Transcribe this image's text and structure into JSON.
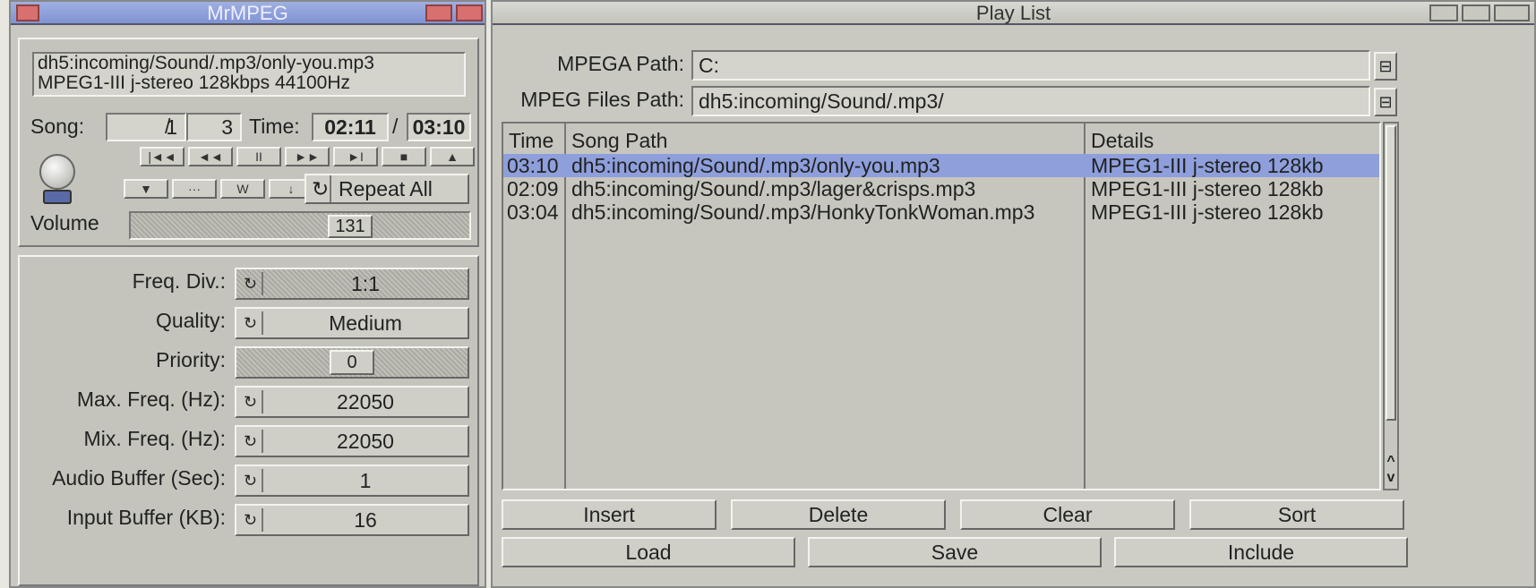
{
  "left_window": {
    "title": "MrMPEG",
    "file_line": "dh5:incoming/Sound/.mp3/only-you.mp3",
    "info_line": "MPEG1-III j-stereo 128kbps 44100Hz",
    "song_label": "Song:",
    "song_current": "1",
    "song_sep": "/",
    "song_total": "3",
    "time_label": "Time:",
    "time_elapsed": "02:11",
    "time_sep": "/",
    "time_total": "03:10",
    "transport": [
      "|◄◄",
      "◄◄",
      "II",
      "►►",
      "►I",
      "■",
      "▲"
    ],
    "transport2": [
      "▼",
      "···",
      "W",
      "↓"
    ],
    "repeat_icon": "↻",
    "repeat_label": "Repeat All",
    "volume_label": "Volume",
    "volume_value": "131",
    "settings": [
      {
        "label": "Freq. Div.:",
        "value": "1:1",
        "disabled": true,
        "cycle": true
      },
      {
        "label": "Quality:",
        "value": "Medium",
        "disabled": false,
        "cycle": true
      },
      {
        "label": "Priority:",
        "value": "0",
        "disabled": true,
        "cycle": false
      },
      {
        "label": "Max. Freq. (Hz):",
        "value": "22050",
        "disabled": false,
        "cycle": true
      },
      {
        "label": "Mix. Freq. (Hz):",
        "value": "22050",
        "disabled": false,
        "cycle": true
      },
      {
        "label": "Audio Buffer (Sec):",
        "value": "1",
        "disabled": false,
        "cycle": true
      },
      {
        "label": "Input Buffer (KB):",
        "value": "16",
        "disabled": false,
        "cycle": true
      }
    ]
  },
  "playlist": {
    "title": "Play List",
    "mpega_label": "MPEGA Path:",
    "mpega_value": "C:",
    "files_label": "MPEG Files Path:",
    "files_value": "dh5:incoming/Sound/.mp3/",
    "columns": [
      "Time",
      "Song Path",
      "Details"
    ],
    "rows": [
      {
        "time": "03:10",
        "path": "dh5:incoming/Sound/.mp3/only-you.mp3",
        "details": "MPEG1-III j-stereo 128kb",
        "selected": true
      },
      {
        "time": "02:09",
        "path": "dh5:incoming/Sound/.mp3/lager&crisps.mp3",
        "details": "MPEG1-III j-stereo 128kb",
        "selected": false
      },
      {
        "time": "03:04",
        "path": "dh5:incoming/Sound/.mp3/HonkyTonkWoman.mp3",
        "details": "MPEG1-III j-stereo 128kb",
        "selected": false
      }
    ],
    "buttons_row1": [
      "Insert",
      "Delete",
      "Clear",
      "Sort"
    ],
    "buttons_row2": [
      "Load",
      "Save",
      "Include"
    ],
    "scroll_up": "^",
    "scroll_down": "v"
  }
}
